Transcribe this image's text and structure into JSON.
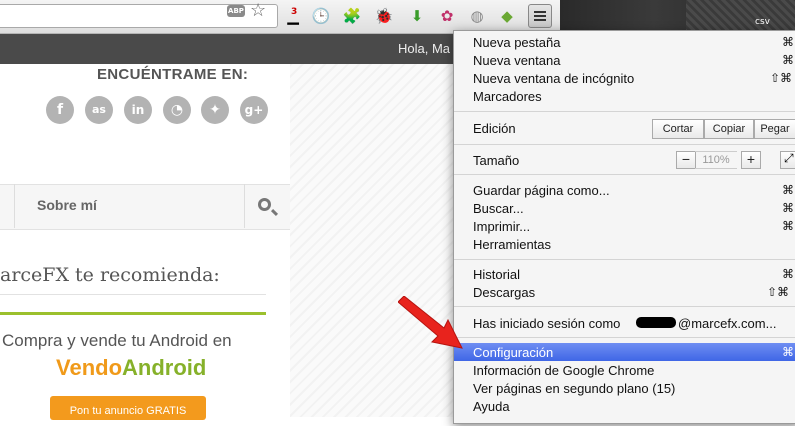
{
  "toolbar": {
    "abp_label": "ABP",
    "extension_badge": "3"
  },
  "desktop": {
    "file_label": "csv"
  },
  "site": {
    "greeting": "Hola, Ma",
    "find_me_title": "ENCUÉNTRAME EN:",
    "social_icons": [
      "facebook-icon",
      "lastfm-icon",
      "linkedin-icon",
      "rss-icon",
      "twitter-icon",
      "googleplus-icon"
    ],
    "nav_about": "Sobre mí",
    "recommend_heading": "arceFX te recomienda:",
    "ad": {
      "line1": "Compra y vende tu Android en",
      "brand_part1": "Vendo",
      "brand_part2": "Android",
      "cta": "Pon tu anuncio GRATIS"
    }
  },
  "menu": {
    "new_tab": "Nueva pestaña",
    "new_window": "Nueva ventana",
    "incognito": "Nueva ventana de incógnito",
    "bookmarks": "Marcadores",
    "edit_label": "Edición",
    "cut": "Cortar",
    "copy": "Copiar",
    "paste": "Pegar",
    "zoom_label": "Tamaño",
    "zoom_minus": "−",
    "zoom_value": "110%",
    "zoom_plus": "+",
    "save_page": "Guardar página como...",
    "find": "Buscar...",
    "print": "Imprimir...",
    "tools": "Herramientas",
    "history": "Historial",
    "downloads": "Descargas",
    "signed_in_prefix": "Has iniciado sesión como",
    "signed_in_suffix": "@marcefx.com...",
    "settings": "Configuración",
    "about_chrome": "Información de Google Chrome",
    "background_pages": "Ver páginas en segundo plano (15)",
    "help": "Ayuda",
    "shortcut_new_tab": "⌘",
    "shortcut_new_window": "⌘",
    "shortcut_incognito": "⇧⌘",
    "shortcut_save": "⌘",
    "shortcut_find": "⌘",
    "shortcut_print": "⌘",
    "shortcut_history": "⌘",
    "shortcut_downloads": "⇧⌘",
    "shortcut_settings": "⌘"
  },
  "colors": {
    "highlight": "#3f66e6",
    "arrow": "#e8231d",
    "ad_green": "#9bc02d",
    "ad_orange": "#f39a1d"
  }
}
